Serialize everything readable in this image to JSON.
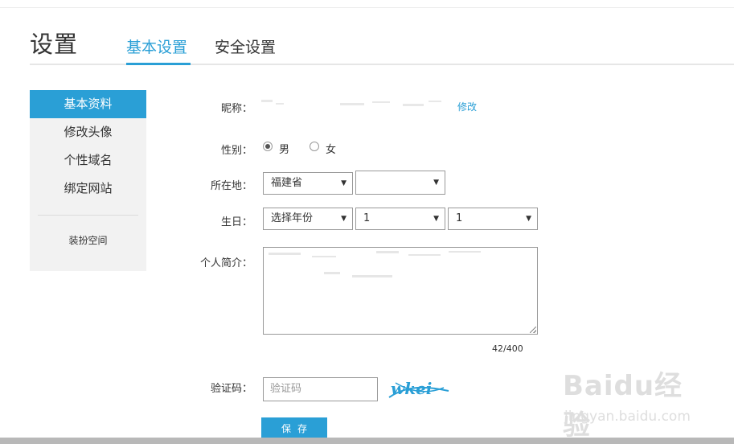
{
  "header": {
    "title": "设置",
    "tabs": [
      {
        "label": "基本设置",
        "active": true
      },
      {
        "label": "安全设置",
        "active": false
      }
    ]
  },
  "sidebar": {
    "items": [
      {
        "label": "基本资料",
        "active": true
      },
      {
        "label": "修改头像",
        "active": false
      },
      {
        "label": "个性域名",
        "active": false
      },
      {
        "label": "绑定网站",
        "active": false
      }
    ],
    "sub_link": "装扮空间"
  },
  "form": {
    "nickname": {
      "label": "昵称：",
      "edit_link": "修改"
    },
    "gender": {
      "label": "性别：",
      "options": [
        "男",
        "女"
      ],
      "selected": "男"
    },
    "location": {
      "label": "所在地：",
      "province": "福建省",
      "city": "",
      "district": ""
    },
    "birthday": {
      "label": "生日：",
      "year": "选择年份",
      "month": "1",
      "day": "1"
    },
    "bio": {
      "label": "个人简介：",
      "counter": "42/400"
    },
    "captcha": {
      "label": "验证码：",
      "placeholder": "验证码",
      "image_text": "wkei"
    },
    "save_label": "保存"
  },
  "watermark": {
    "logo": "Baidu经验",
    "url": "jingyan.baidu.com"
  },
  "colors": {
    "accent": "#2a9fd6",
    "sidebar_bg": "#f2f2f2",
    "border": "#999999"
  }
}
